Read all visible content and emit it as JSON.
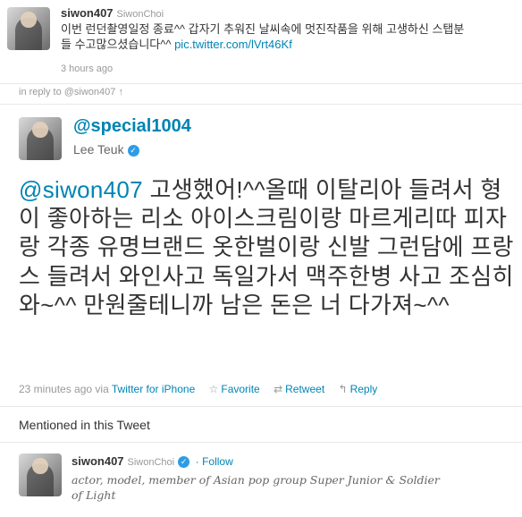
{
  "reply_tweet": {
    "username": "siwon407",
    "display_name": "SiwonChoi",
    "text_line1": "이번 런던촬영일정 종료^^ 갑자기 추워진 날씨속에 멋진작품을 위해 고생하신 스탭분",
    "text_line2": "들 수고많으셨습니다^^",
    "link": "pic.twitter.com/lVrt46Kf",
    "time": "3 hours ago"
  },
  "in_reply_to": "in reply to @siwon407 ↑",
  "main_tweet": {
    "handle": "@special1004",
    "name": "Lee Teuk",
    "mention": "@siwon407",
    "text": " 고생했어!^^올때 이탈리아 들려서 형이 좋아하는 리소 아이스크림이랑 마르게리따 피자랑 각종 유명브랜드 옷한벌이랑 신발 그런담에 프랑스 들려서 와인사고 독일가서 맥주한병 사고 조심히와~^^ 만원줄테니까 남은 돈은 너 다가져~^^",
    "time": "23 minutes ago",
    "via": "via",
    "client": "Twitter for iPhone",
    "actions": {
      "favorite": "Favorite",
      "retweet": "Retweet",
      "reply": "Reply"
    }
  },
  "mentioned": {
    "title": "Mentioned in this Tweet",
    "username": "siwon407",
    "display_name": "SiwonChoi",
    "follow": "Follow",
    "bio": "actor, model, member of Asian pop group Super Junior & Soldier of Light"
  },
  "icons": {
    "verified": "verified-badge-icon",
    "favorite": "star-icon",
    "retweet": "retweet-icon",
    "reply": "reply-arrow-icon"
  }
}
